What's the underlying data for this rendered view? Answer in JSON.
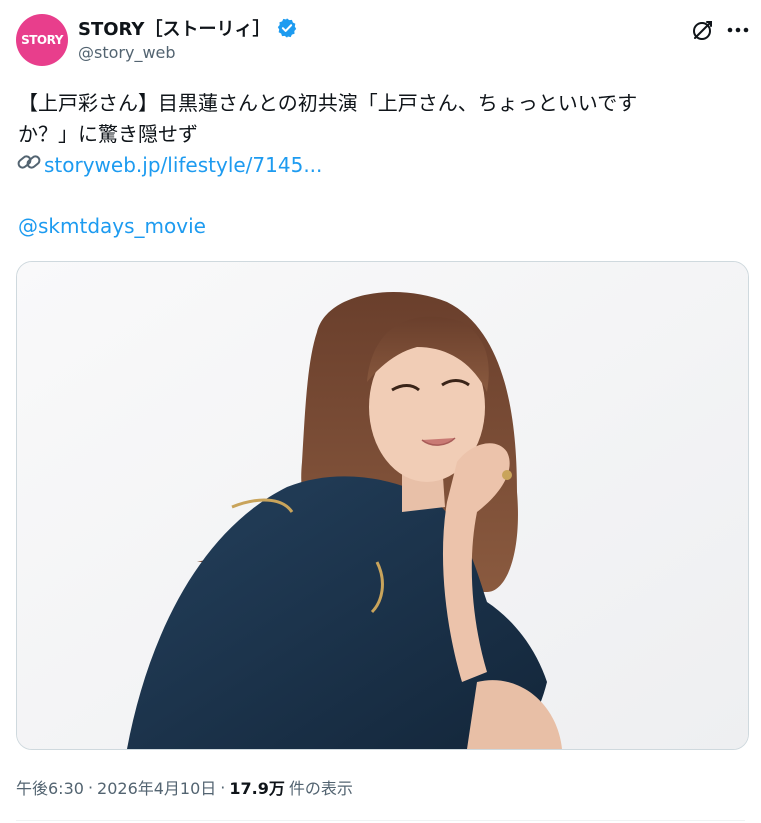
{
  "header": {
    "avatar_text": "STORY",
    "display_name": "STORY［ストーリィ］",
    "handle": "@story_web"
  },
  "tweet": {
    "text_line1": "【上戸彩さん】目黒蓮さんとの初共演「上戸さん、ちょっといいです",
    "text_line2": "か？」に驚き隠せず",
    "link_text": "storyweb.jp/lifestyle/7145...",
    "mention": "@skmtdays_movie"
  },
  "meta": {
    "time": "午後6:30",
    "sep1": "·",
    "date": "2026年4月10日",
    "sep2": "·",
    "views_count": "17.9万",
    "views_label": "件の表示"
  },
  "colors": {
    "accent": "#1d9bf0",
    "avatar_bg": "#e83e8c",
    "text": "#0f1419",
    "secondary": "#536471",
    "verified": "#1d9bf0"
  },
  "icons": {
    "verified": "verified-badge-icon",
    "grok": "grok-icon",
    "more": "more-dots-icon",
    "link": "link-chain-icon"
  }
}
